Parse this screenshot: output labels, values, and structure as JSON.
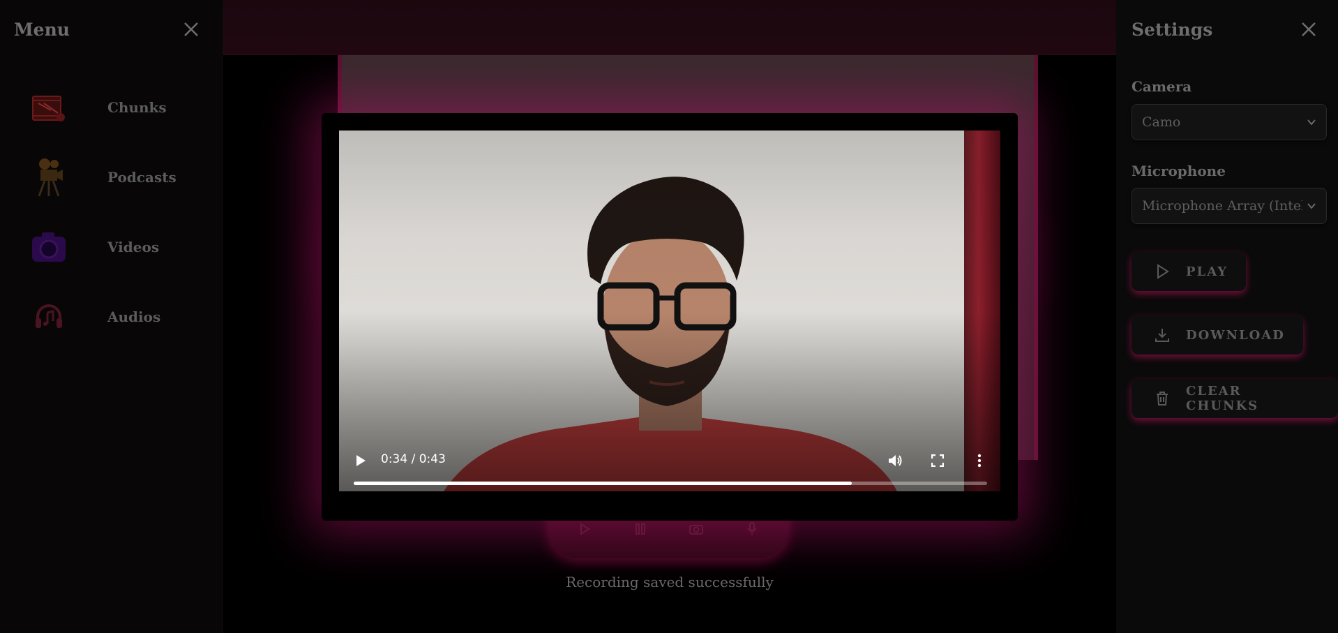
{
  "menu": {
    "title": "Menu",
    "items": [
      {
        "label": "Chunks",
        "icon": "film-clapper-icon"
      },
      {
        "label": "Podcasts",
        "icon": "film-camera-icon"
      },
      {
        "label": "Videos",
        "icon": "camera-icon"
      },
      {
        "label": "Audios",
        "icon": "headphones-music-icon"
      }
    ]
  },
  "settings": {
    "title": "Settings",
    "camera_label": "Camera",
    "camera_value": "Camo",
    "microphone_label": "Microphone",
    "microphone_value": "Microphone Array (Intel®",
    "play_label": "PLAY",
    "download_label": "DOWNLOAD",
    "clear_label": "CLEAR CHUNKS"
  },
  "status": "Recording saved successfully",
  "player": {
    "time": "0:34 / 0:43",
    "progress": 0.786
  },
  "colors": {
    "accent": "#c8146e",
    "glow": "#b4146e"
  }
}
